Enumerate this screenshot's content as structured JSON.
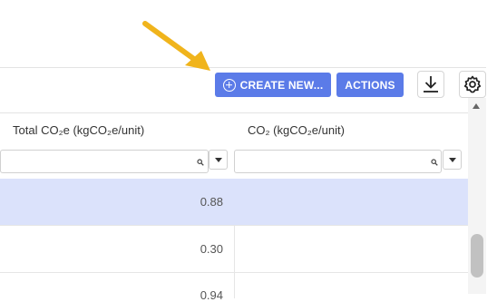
{
  "toolbar": {
    "create_new_label": "CREATE NEW...",
    "actions_label": "ACTIONS"
  },
  "table": {
    "columns": [
      "Total CO₂e (kgCO₂e/unit)",
      "CO₂ (kgCO₂e/unit)"
    ],
    "filters": [
      {
        "value": "",
        "placeholder": ""
      },
      {
        "value": "",
        "placeholder": ""
      }
    ],
    "rows": [
      {
        "total_co2e": "0.88",
        "co2": "",
        "selected": true
      },
      {
        "total_co2e": "0.30",
        "co2": "",
        "selected": false
      },
      {
        "total_co2e": "0.94",
        "co2": "",
        "selected": false
      }
    ]
  },
  "icons": {
    "download": "download-icon",
    "settings": "gear-icon",
    "create": "plus-circle-icon",
    "search": "search-icon",
    "dropdown": "chevron-down-icon",
    "annotation": "arrow-annotation"
  },
  "colors": {
    "primary": "#5b7be8",
    "selected_row": "#dbe2fb",
    "annotation_arrow": "#f0b41c"
  }
}
